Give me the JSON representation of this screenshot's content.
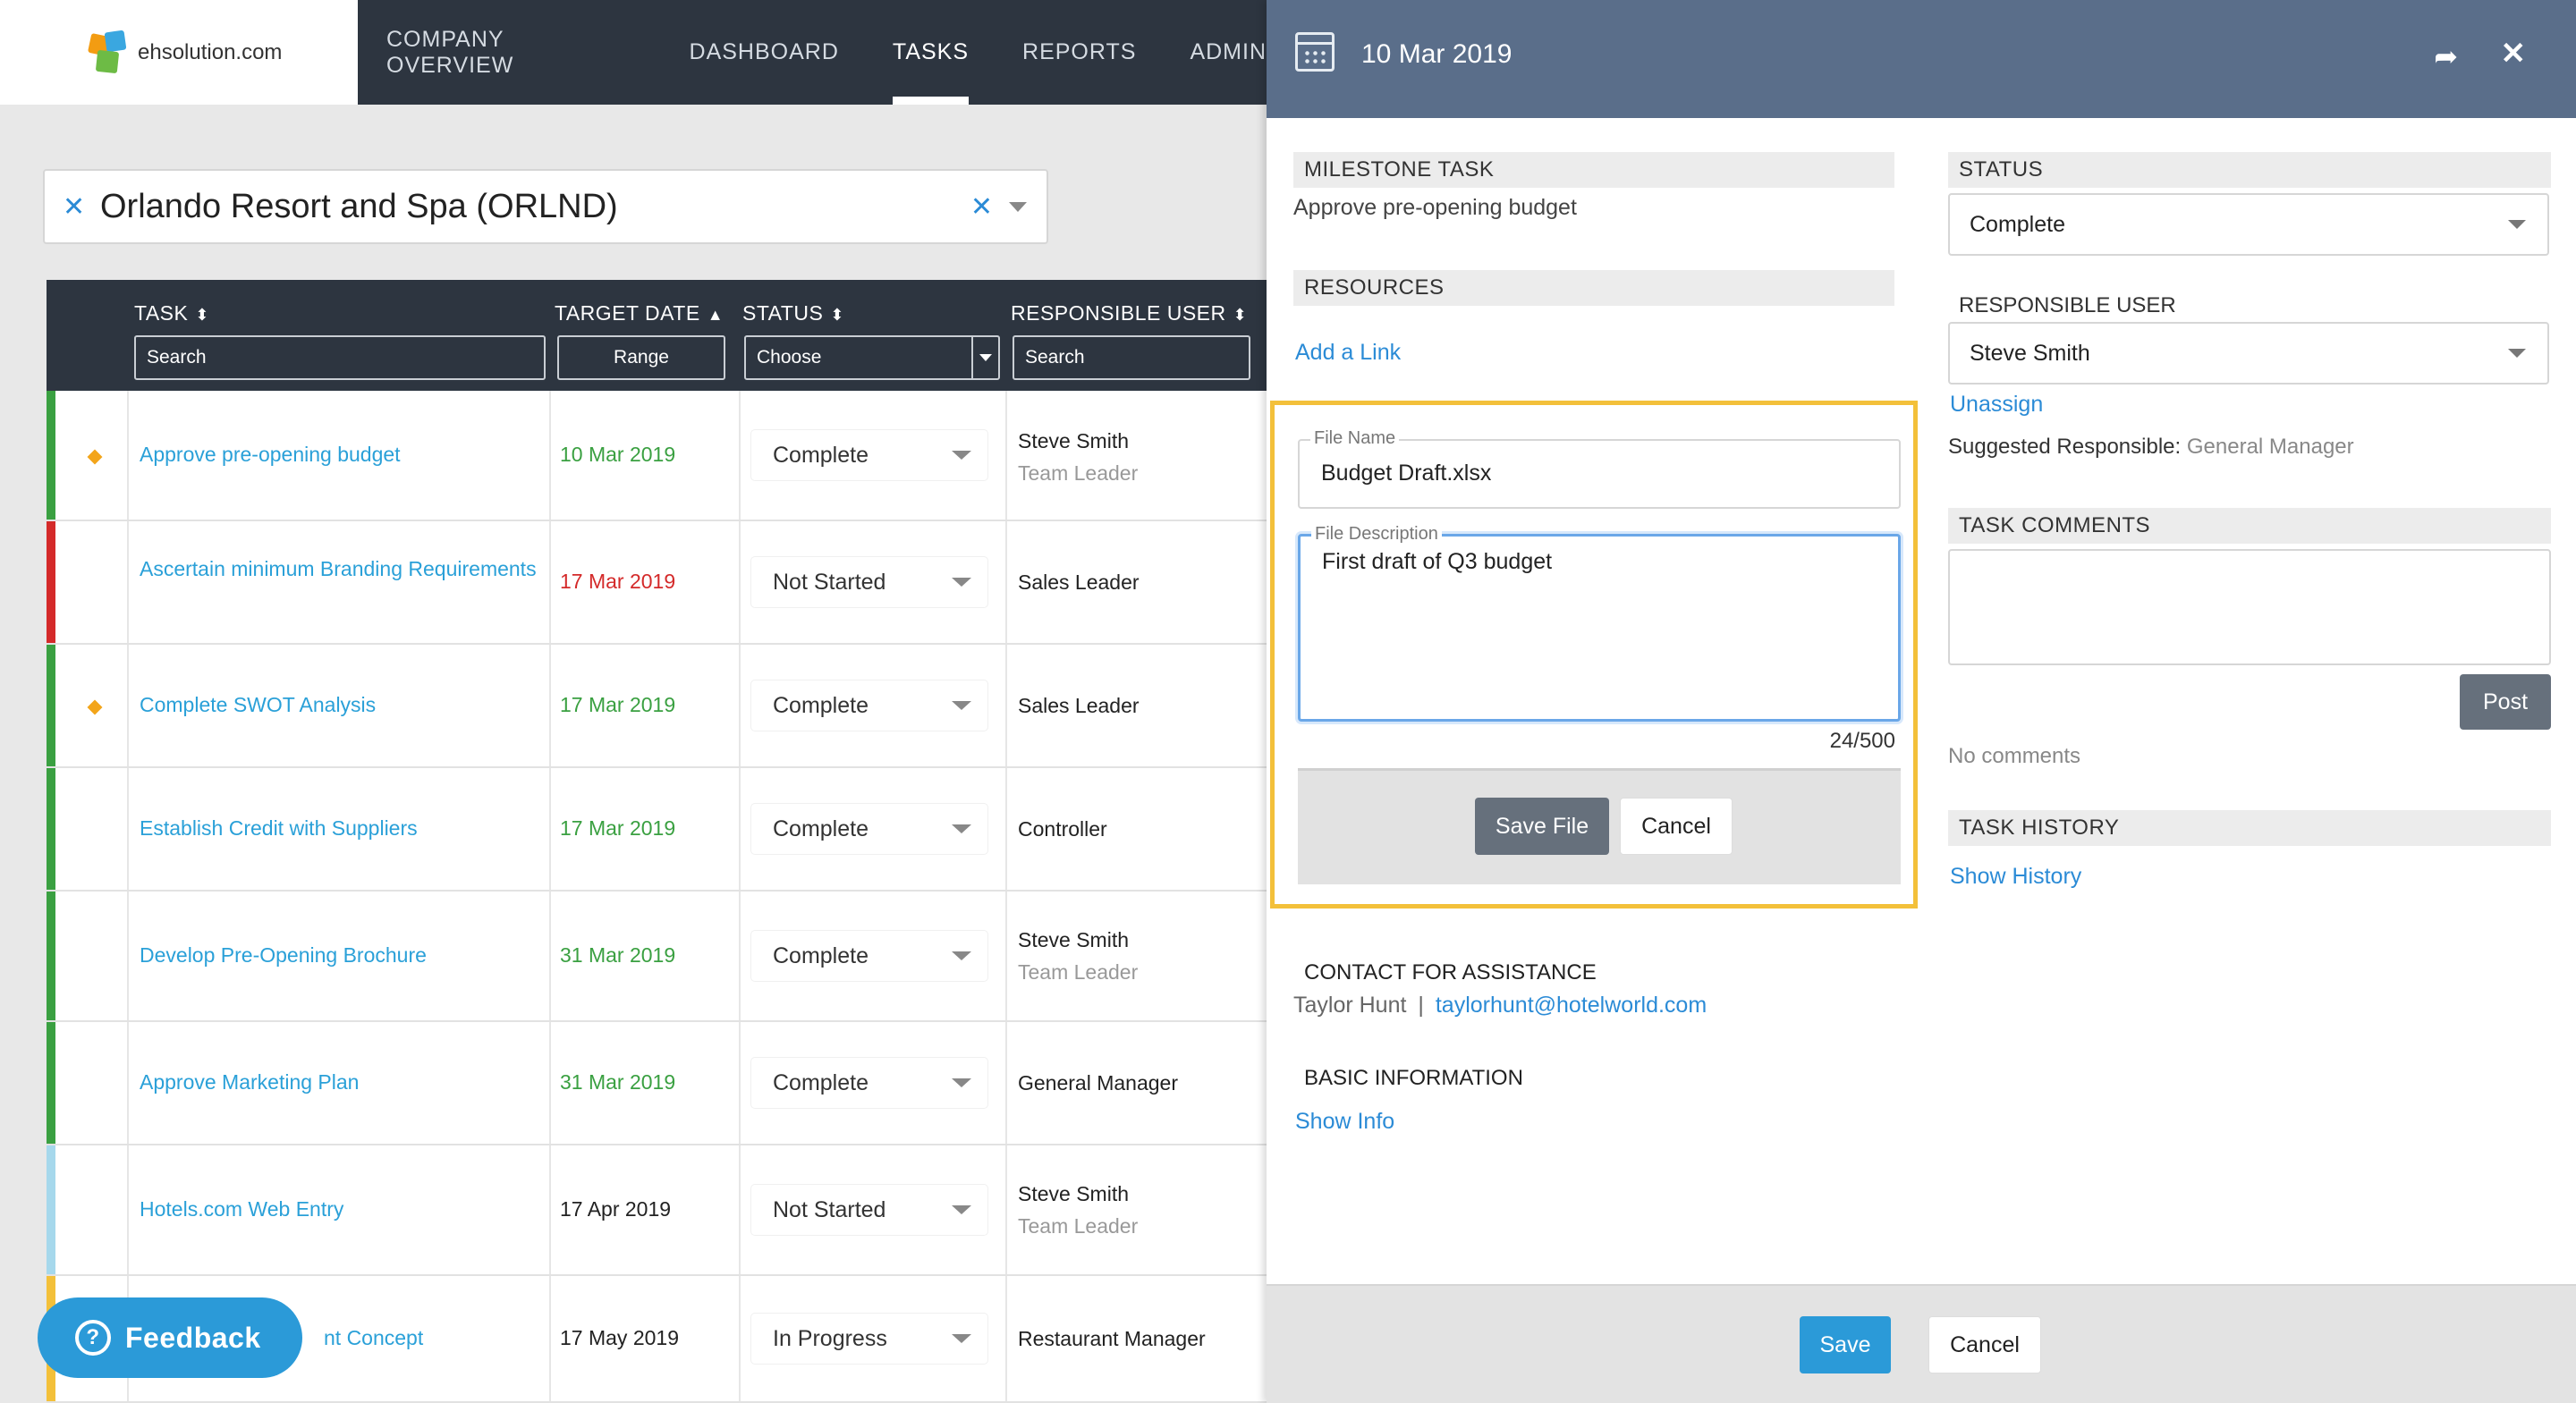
{
  "brand": {
    "logo_text": "ehsolution.com"
  },
  "nav": [
    {
      "label": "COMPANY OVERVIEW"
    },
    {
      "label": "DASHBOARD"
    },
    {
      "label": "TASKS"
    },
    {
      "label": "REPORTS"
    },
    {
      "label": "ADMIN"
    }
  ],
  "location": {
    "value": "Orlando Resort and Spa (ORLND)"
  },
  "table": {
    "headers": {
      "task": "TASK",
      "target_date": "TARGET DATE",
      "status": "STATUS",
      "responsible": "RESPONSIBLE USER"
    },
    "filters": {
      "task": "Search",
      "date": "Range",
      "status": "Choose",
      "responsible": "Search"
    },
    "rows": [
      {
        "task": "Approve pre-opening budget",
        "date": "10 Mar 2019",
        "status": "Complete",
        "user": "Steve Smith",
        "user_sub": "Team Leader"
      },
      {
        "task": "Ascertain minimum Branding Requirements",
        "date": "17 Mar 2019",
        "status": "Not Started",
        "user": "Sales Leader",
        "user_sub": ""
      },
      {
        "task": "Complete SWOT Analysis",
        "date": "17 Mar 2019",
        "status": "Complete",
        "user": "Sales Leader",
        "user_sub": ""
      },
      {
        "task": "Establish Credit with Suppliers",
        "date": "17 Mar 2019",
        "status": "Complete",
        "user": "Controller",
        "user_sub": ""
      },
      {
        "task": "Develop Pre-Opening Brochure",
        "date": "31 Mar 2019",
        "status": "Complete",
        "user": "Steve Smith",
        "user_sub": "Team Leader"
      },
      {
        "task": "Approve Marketing Plan",
        "date": "31 Mar 2019",
        "status": "Complete",
        "user": "General Manager",
        "user_sub": ""
      },
      {
        "task": "Hotels.com Web Entry",
        "date": "17 Apr 2019",
        "status": "Not Started",
        "user": "Steve Smith",
        "user_sub": "Team Leader"
      },
      {
        "task": "nt Concept",
        "date": "17 May 2019",
        "status": "In Progress",
        "user": "Restaurant Manager",
        "user_sub": ""
      }
    ]
  },
  "feedback": {
    "label": "Feedback"
  },
  "panel": {
    "date": "10 Mar 2019",
    "milestone": {
      "title": "MILESTONE TASK",
      "value": "Approve pre-opening budget"
    },
    "resources": {
      "title": "RESOURCES",
      "add_link": "Add a Link"
    },
    "file": {
      "name_label": "File Name",
      "name_value": "Budget Draft.xlsx",
      "desc_label": "File Description",
      "desc_value": "First draft of Q3 budget",
      "char_count": "24/500",
      "save_label": "Save File",
      "cancel_label": "Cancel"
    },
    "contact": {
      "title": "CONTACT FOR ASSISTANCE",
      "name": "Taylor Hunt",
      "sep": "|",
      "email": "taylorhunt@hotelworld.com"
    },
    "basic": {
      "title": "BASIC INFORMATION",
      "link": "Show Info"
    },
    "status": {
      "title": "STATUS",
      "value": "Complete"
    },
    "responsible": {
      "title": "RESPONSIBLE USER",
      "value": "Steve Smith",
      "unassign": "Unassign",
      "suggested_label": "Suggested Responsible:",
      "suggested_value": "General Manager"
    },
    "comments": {
      "title": "TASK COMMENTS",
      "post_label": "Post",
      "empty": "No comments"
    },
    "history": {
      "title": "TASK HISTORY",
      "link": "Show History"
    },
    "footer": {
      "save": "Save",
      "cancel": "Cancel"
    }
  },
  "colors": {
    "nav_bg": "#2d3540",
    "panel_header": "#5a6e8a",
    "accent_blue": "#2b9ad8",
    "highlight": "#f3c03a",
    "status_green": "#3aa041",
    "status_red": "#d42a2a"
  }
}
